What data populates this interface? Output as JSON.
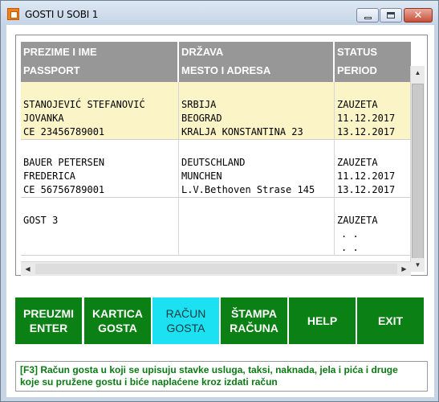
{
  "window": {
    "title": "GOSTI U SOBI 1"
  },
  "grid": {
    "header": {
      "col1": [
        "PREZIME I IME",
        "PASSPORT"
      ],
      "col2": [
        "DRŽAVA",
        "MESTO I ADRESA"
      ],
      "col3": [
        "STATUS",
        "PERIOD"
      ]
    },
    "rows": [
      {
        "col1": [
          "STANOJEVIĆ STEFANOVIĆ",
          "JOVANKA",
          "CE 23456789001"
        ],
        "col2": [
          "SRBIJA",
          "BEOGRAD",
          "KRALJA KONSTANTINA 23"
        ],
        "col3": [
          "ZAUZETA",
          "11.12.2017",
          "13.12.2017"
        ],
        "selected": true
      },
      {
        "col1": [
          "BAUER PETERSEN",
          "FREDERICA",
          "CE 56756789001"
        ],
        "col2": [
          "DEUTSCHLAND",
          "MUNCHEN",
          "L.V.Bethoven Strase 145"
        ],
        "col3": [
          "ZAUZETA",
          "11.12.2017",
          "13.12.2017"
        ],
        "selected": false
      },
      {
        "col1": [
          "GOST 3",
          "",
          ""
        ],
        "col2": [
          "",
          "",
          ""
        ],
        "col3": [
          "ZAUZETA",
          ". .",
          ". ."
        ],
        "selected": false
      }
    ]
  },
  "buttons": [
    {
      "line1": "PREUZMI",
      "line2": "ENTER",
      "active": false
    },
    {
      "line1": "KARTICA",
      "line2": "GOSTA",
      "active": false
    },
    {
      "line1": "RAČUN",
      "line2": "GOSTA",
      "active": true
    },
    {
      "line1": "ŠTAMPA",
      "line2": "RAČUNA",
      "active": false
    },
    {
      "line1": "HELP",
      "line2": "",
      "active": false
    },
    {
      "line1": "EXIT",
      "line2": "",
      "active": false
    }
  ],
  "info": {
    "line1": "[F3] Račun gosta u koji se upisuju stavke usluga, taksi, naknada, jela i pića i druge",
    "line2": "koje su pružene gostu i biće naplaćene kroz izdati račun"
  },
  "icons": {
    "app": "app-icon",
    "minimize": "minimize-icon",
    "maximize": "maximize-icon",
    "close": "close-icon"
  },
  "colors": {
    "button_green": "#0b8014",
    "button_active": "#1ce1f2",
    "selected_row": "#fbf4c6",
    "header_gray": "#979797",
    "info_text": "#0b7a14"
  }
}
